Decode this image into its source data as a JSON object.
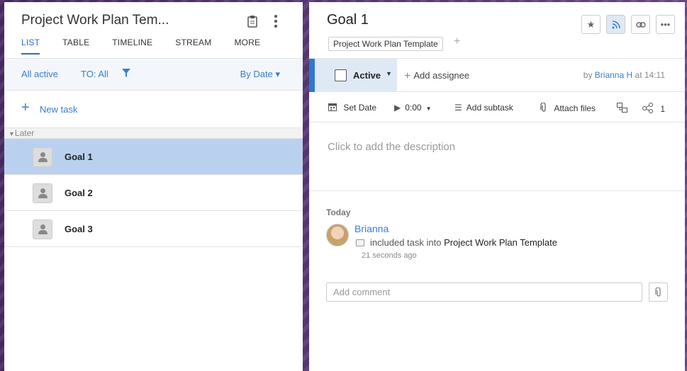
{
  "left": {
    "title": "Project Work Plan Tem...",
    "tabs": [
      "LIST",
      "TABLE",
      "TIMELINE",
      "STREAM",
      "MORE"
    ],
    "filters": {
      "all_active": "All active",
      "to_all": "TO: All",
      "sort": "By Date ▾"
    },
    "new_task": "New task",
    "group_label": "Later",
    "tasks": [
      {
        "name": "Goal 1",
        "selected": true
      },
      {
        "name": "Goal 2",
        "selected": false
      },
      {
        "name": "Goal 3",
        "selected": false
      }
    ]
  },
  "right": {
    "title": "Goal 1",
    "folder": "Project Work Plan Template",
    "status": "Active",
    "add_assignee": "Add assignee",
    "byline_prefix": "by",
    "author": "Brianna H",
    "byline_time": "at 14:11",
    "toolbar": {
      "set_date": "Set Date",
      "duration": "0:00",
      "add_subtask": "Add subtask",
      "attach_files": "Attach files",
      "share_count": "1"
    },
    "description_placeholder": "Click to add the description",
    "activity": {
      "day": "Today",
      "user": "Brianna",
      "action": "included task into",
      "target": "Project Work Plan Template",
      "time": "21 seconds ago"
    },
    "comment_placeholder": "Add comment"
  },
  "colors": {
    "accent": "#2e78d2",
    "link": "#3a7ec9",
    "selected_row": "#b9d1ef"
  },
  "icons": [
    "clipboard-icon",
    "more-vertical-icon",
    "filter-icon",
    "plus-icon",
    "caret-down-icon",
    "user-avatar-icon",
    "star-icon",
    "rss-icon",
    "link-icon",
    "more-horizontal-icon",
    "calendar-icon",
    "play-icon",
    "subtask-icon",
    "paperclip-icon",
    "dependency-icon",
    "share-icon",
    "folder-icon"
  ]
}
